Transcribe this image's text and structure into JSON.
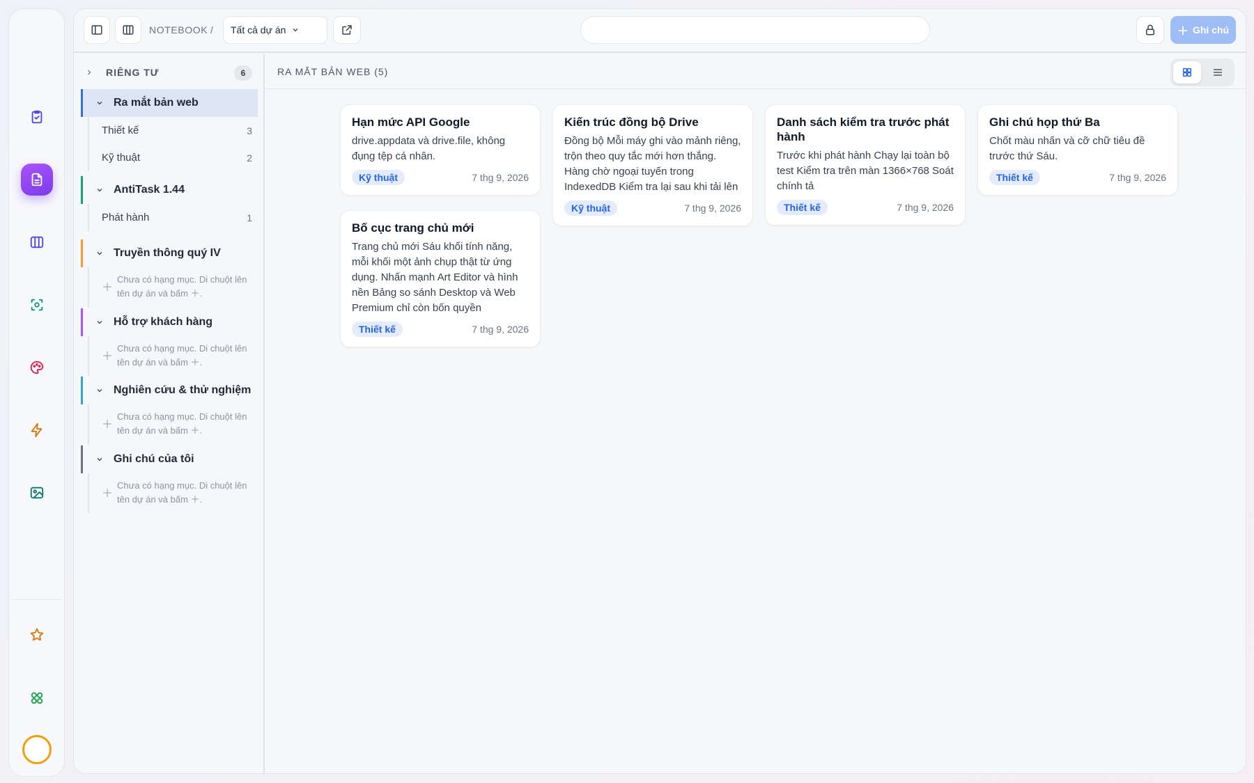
{
  "colors": {
    "accent": "#7c3aed",
    "primary_button": "#9ebcf6",
    "tag_text": "#2563eb",
    "tag_bg": "#e4ecfb",
    "project_bars": [
      "#3b6fd8",
      "#16a37a",
      "#f29b38",
      "#a855f7",
      "#38a5c6",
      "#6b7280"
    ]
  },
  "rail": {
    "icons": [
      "task-check-icon",
      "notes-icon",
      "board-columns-icon",
      "scan-icon",
      "palette-icon",
      "lightning-icon",
      "image-icon",
      "star-icon",
      "apps-grid-icon"
    ]
  },
  "topbar": {
    "breadcrumb_root": "NOTEBOOK",
    "breadcrumb_sep": "/",
    "project_select": "Tất cả dự án",
    "search_placeholder": "",
    "new_note_label": "Ghi chú"
  },
  "sidebar": {
    "private_label": "RIÊNG TƯ",
    "private_count": "6",
    "empty_text": "Chưa có hạng mục. Di chuột lên tên dự án và bấm ＋.",
    "projects": [
      {
        "name": "Ra mắt bản web",
        "categories": [
          {
            "name": "Thiết kế",
            "count": "3"
          },
          {
            "name": "Kỹ thuật",
            "count": "2"
          }
        ]
      },
      {
        "name": "AntiTask 1.44",
        "categories": [
          {
            "name": "Phát hành",
            "count": "1"
          }
        ]
      },
      {
        "name": "Truyền thông quý IV",
        "categories": []
      },
      {
        "name": "Hỗ trợ khách hàng",
        "categories": []
      },
      {
        "name": "Nghiên cứu & thử nghiệm",
        "categories": []
      },
      {
        "name": "Ghi chú của tôi",
        "categories": []
      }
    ]
  },
  "content": {
    "title": "RA MẮT BẢN WEB (5)",
    "cards": [
      {
        "title": "Hạn mức API Google",
        "body": "drive.appdata và drive.file, không đụng tệp cá nhân.",
        "tag": "Kỹ thuật",
        "date": "7 thg 9, 2026"
      },
      {
        "title": "Kiến trúc đồng bộ Drive",
        "body": "Đồng bộ Mỗi máy ghi vào mảnh riêng, trộn theo quy tắc mới hơn thắng. Hàng chờ ngoại tuyến trong IndexedDB Kiểm tra lại sau khi tải lên",
        "tag": "Kỹ thuật",
        "date": "7 thg 9, 2026"
      },
      {
        "title": "Danh sách kiểm tra trước phát hành",
        "body": "Trước khi phát hành Chạy lại toàn bộ test Kiểm tra trên màn 1366×768 Soát chính tả",
        "tag": "Thiết kế",
        "date": "7 thg 9, 2026"
      },
      {
        "title": "Ghi chú họp thứ Ba",
        "body": "Chốt màu nhấn và cỡ chữ tiêu đề trước thứ Sáu.",
        "tag": "Thiết kế",
        "date": "7 thg 9, 2026"
      },
      {
        "title": "Bố cục trang chủ mới",
        "body": "Trang chủ mới Sáu khối tính năng, mỗi khối một ảnh chụp thật từ ứng dụng. Nhấn mạnh Art Editor và hình nền Bảng so sánh Desktop và Web Premium chỉ còn bốn quyền",
        "tag": "Thiết kế",
        "date": "7 thg 9, 2026"
      }
    ]
  }
}
